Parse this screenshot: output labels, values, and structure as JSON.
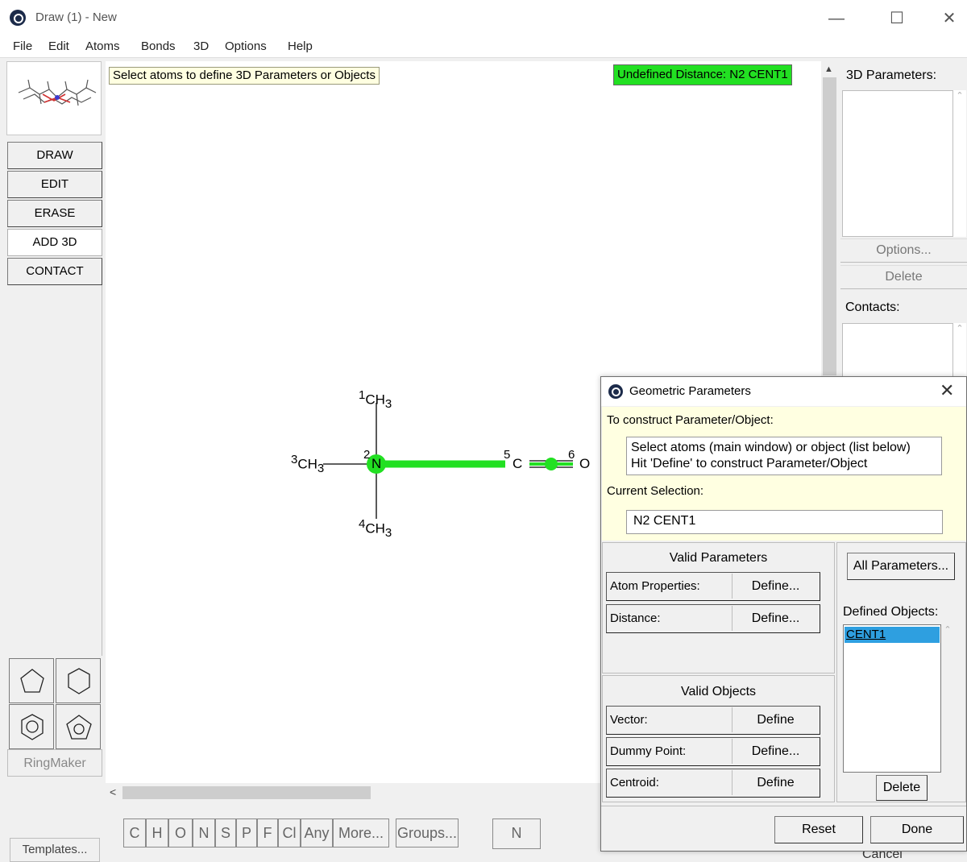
{
  "window": {
    "title": "Draw (1) - New"
  },
  "menu": [
    "File",
    "Edit",
    "Atoms",
    "Bonds",
    "3D",
    "Options",
    "Help"
  ],
  "modes": [
    "DRAW",
    "EDIT",
    "ERASE",
    "ADD 3D",
    "CONTACT"
  ],
  "active_mode": "ADD 3D",
  "ringmaker_label": "RingMaker",
  "templates_label": "Templates...",
  "canvas": {
    "hint": "Select atoms to define 3D Parameters or Objects",
    "status": "Undefined Distance: N2 CENT1",
    "accent_color": "#22e022",
    "atoms": {
      "a1": {
        "num": "1",
        "label": "CH",
        "sub": "3"
      },
      "a2": {
        "num": "2",
        "label": "N"
      },
      "a3": {
        "num": "3",
        "label": "CH",
        "sub": "3"
      },
      "a4": {
        "num": "4",
        "label": "CH",
        "sub": "3"
      },
      "a5": {
        "num": "5",
        "label": "C"
      },
      "a6": {
        "num": "6",
        "label": "O"
      }
    }
  },
  "element_buttons": [
    "C",
    "H",
    "O",
    "N",
    "S",
    "P",
    "F",
    "Cl",
    "Any",
    "More...",
    "Groups...",
    "N"
  ],
  "right_panel": {
    "params_label": "3D Parameters:",
    "options_label": "Options...",
    "delete_label": "Delete",
    "contacts_label": "Contacts:",
    "cancel_label": "Cancel"
  },
  "dialog": {
    "title": "Geometric Parameters",
    "construct_label": "To construct Parameter/Object:",
    "instr_line1": "Select atoms (main window) or object (list below)",
    "instr_line2": "Hit 'Define' to construct Parameter/Object",
    "current_label": "Current Selection:",
    "current_value": "N2 CENT1",
    "valid_params_label": "Valid Parameters",
    "params": [
      {
        "label": "Atom Properties:",
        "button": "Define..."
      },
      {
        "label": "Distance:",
        "button": "Define..."
      }
    ],
    "valid_objects_label": "Valid Objects",
    "objects": [
      {
        "label": "Vector:",
        "button": "Define"
      },
      {
        "label": "Dummy Point:",
        "button": "Define..."
      },
      {
        "label": "Centroid:",
        "button": "Define"
      }
    ],
    "all_params_label": "All Parameters...",
    "defined_objects_label": "Defined Objects:",
    "defined_objects": [
      "CENT1"
    ],
    "delete_label": "Delete",
    "reset_label": "Reset",
    "done_label": "Done"
  }
}
